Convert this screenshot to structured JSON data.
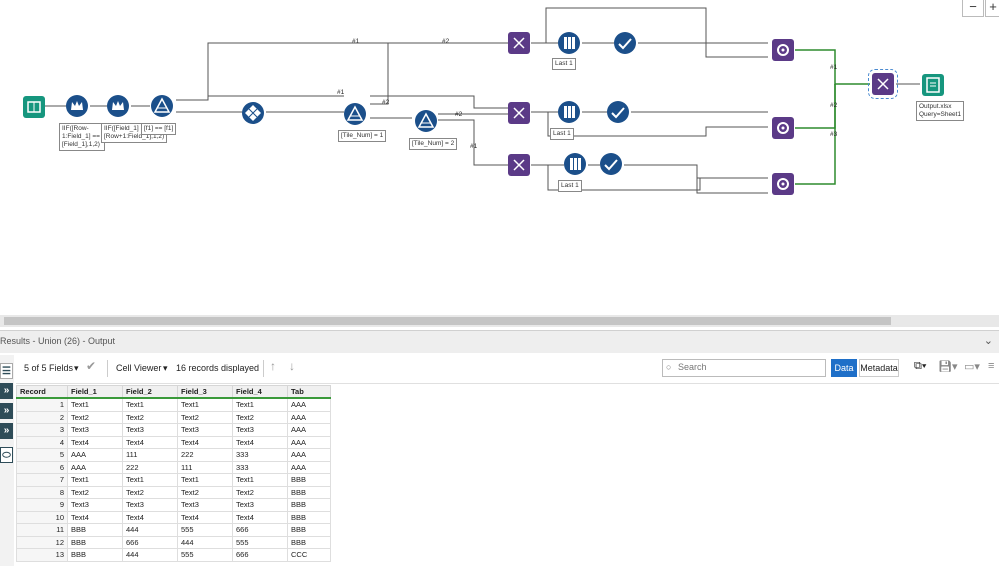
{
  "workflow": {
    "annotations": {
      "formula1": "IIF([Row-1:Field_1] == [Field_1],1,2)",
      "formula2": "IIF([Field_1] != [Row+1:Field_1],1,2)",
      "filter1": "[f1] == [f1]",
      "tile1": "[Tile_Num] = 1",
      "tile2": "[Tile_Num] = 2",
      "sample1": "Last 1",
      "sample2": "Last 1",
      "sample3": "Last 1",
      "output": "Output.xlsx\nQuery=Sheet1"
    },
    "connection_labels": {
      "c1": "#1",
      "c2": "#2",
      "c3": "#1",
      "c4": "#2",
      "c5": "#2",
      "c6": "#1",
      "c7": "#1",
      "c8": "#2",
      "c9": "#3"
    },
    "zoom_out": "−",
    "zoom_in": "+"
  },
  "results": {
    "title": "Results - Union (26) - Output",
    "fields_label": "5 of 5 Fields",
    "viewer_label": "Cell Viewer",
    "records_label": "16 records displayed",
    "search_placeholder": "Search",
    "data_tab": "Data",
    "metadata_tab": "Metadata",
    "columns": [
      "Record",
      "Field_1",
      "Field_2",
      "Field_3",
      "Field_4",
      "Tab"
    ],
    "rows": [
      [
        "1",
        "Text1",
        "Text1",
        "Text1",
        "Text1",
        "AAA"
      ],
      [
        "2",
        "Text2",
        "Text2",
        "Text2",
        "Text2",
        "AAA"
      ],
      [
        "3",
        "Text3",
        "Text3",
        "Text3",
        "Text3",
        "AAA"
      ],
      [
        "4",
        "Text4",
        "Text4",
        "Text4",
        "Text4",
        "AAA"
      ],
      [
        "5",
        "AAA",
        "111",
        "222",
        "333",
        "AAA"
      ],
      [
        "6",
        "AAA",
        "222",
        "111",
        "333",
        "AAA"
      ],
      [
        "7",
        "Text1",
        "Text1",
        "Text1",
        "Text1",
        "BBB"
      ],
      [
        "8",
        "Text2",
        "Text2",
        "Text2",
        "Text2",
        "BBB"
      ],
      [
        "9",
        "Text3",
        "Text3",
        "Text3",
        "Text3",
        "BBB"
      ],
      [
        "10",
        "Text4",
        "Text4",
        "Text4",
        "Text4",
        "BBB"
      ],
      [
        "11",
        "BBB",
        "444",
        "555",
        "666",
        "BBB"
      ],
      [
        "12",
        "BBB",
        "666",
        "444",
        "555",
        "BBB"
      ],
      [
        "13",
        "BBB",
        "444",
        "555",
        "666",
        "CCC"
      ]
    ]
  },
  "colors": {
    "tool_blue": "#1b4f8a",
    "tool_teal": "#16967e",
    "tool_purple": "#5b3a87",
    "accent": "#1e6fc8",
    "connector_green": "#2e8b2e"
  }
}
